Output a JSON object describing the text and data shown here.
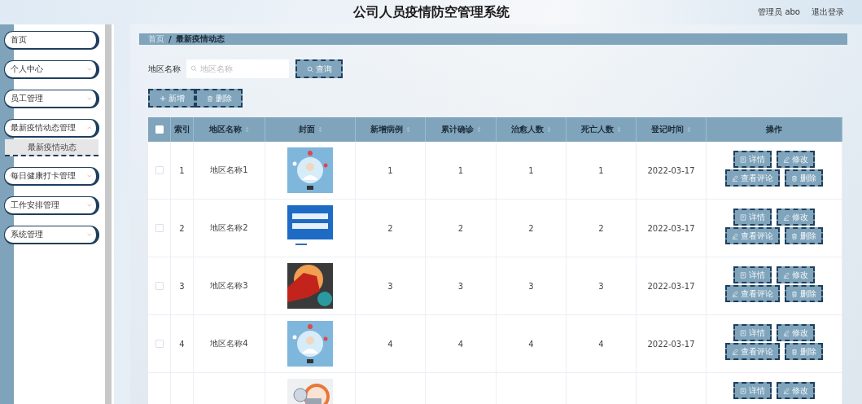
{
  "header": {
    "title": "公司人员疫情防空管理系统",
    "user": "管理员 abo",
    "logout": "退出登录"
  },
  "sidebar": {
    "items": [
      {
        "label": "首页"
      },
      {
        "label": "个人中心",
        "expanded": false
      },
      {
        "label": "员工管理",
        "expanded": false
      },
      {
        "label": "最新疫情动态管理",
        "expanded": true,
        "children": [
          {
            "label": "最新疫情动态",
            "selected": true
          }
        ]
      },
      {
        "label": "每日健康打卡管理",
        "expanded": false
      },
      {
        "label": "工作安排管理",
        "expanded": false
      },
      {
        "label": "系统管理",
        "expanded": false
      }
    ]
  },
  "breadcrumb": [
    "首页",
    "/",
    "最新疫情动态"
  ],
  "search": {
    "label": "地区名称",
    "placeholder": "地区名称",
    "button": "查询"
  },
  "toolbar": [
    {
      "kind": "add",
      "label": "新增"
    },
    {
      "kind": "delete",
      "label": "删除"
    }
  ],
  "table": {
    "columns": [
      {
        "label": "索引",
        "sortable": false
      },
      {
        "label": "地区名称",
        "sortable": true
      },
      {
        "label": "封面",
        "sortable": true
      },
      {
        "label": "新增病例",
        "sortable": true
      },
      {
        "label": "累计确诊",
        "sortable": true
      },
      {
        "label": "治愈人数",
        "sortable": true
      },
      {
        "label": "死亡人数",
        "sortable": true
      },
      {
        "label": "登记时间",
        "sortable": true
      },
      {
        "label": "操作",
        "sortable": false
      }
    ],
    "header_checked": false,
    "rows": [
      {
        "checked": false,
        "cells": [
          "1",
          "地区名称1"
        ],
        "cover": {
          "kind": "picture"
        },
        "values": [
          "1",
          "1",
          "1",
          "1",
          "2022-03-17"
        ],
        "actions": [
          {
            "kind": "detail",
            "label": "详情"
          },
          {
            "kind": "edit",
            "label": "修改"
          },
          {
            "kind": "edit",
            "label": "查看评论"
          },
          {
            "kind": "delete",
            "label": "删除"
          }
        ]
      },
      {
        "checked": false,
        "cells": [
          "2",
          "地区名称2"
        ],
        "cover": {
          "kind": "picture"
        },
        "values": [
          "2",
          "2",
          "2",
          "2",
          "2022-03-17"
        ],
        "actions": [
          {
            "kind": "detail",
            "label": "详情"
          },
          {
            "kind": "edit",
            "label": "修改"
          },
          {
            "kind": "edit",
            "label": "查看评论"
          },
          {
            "kind": "delete",
            "label": "删除"
          }
        ]
      },
      {
        "checked": false,
        "cells": [
          "3",
          "地区名称3"
        ],
        "cover": {
          "kind": "picture"
        },
        "values": [
          "3",
          "3",
          "3",
          "3",
          "2022-03-17"
        ],
        "actions": [
          {
            "kind": "detail",
            "label": "详情"
          },
          {
            "kind": "edit",
            "label": "修改"
          },
          {
            "kind": "edit",
            "label": "查看评论"
          },
          {
            "kind": "delete",
            "label": "删除"
          }
        ]
      },
      {
        "checked": false,
        "cells": [
          "4",
          "地区名称4"
        ],
        "cover": {
          "kind": "picture"
        },
        "values": [
          "4",
          "4",
          "4",
          "4",
          "2022-03-17"
        ],
        "actions": [
          {
            "kind": "detail",
            "label": "详情"
          },
          {
            "kind": "edit",
            "label": "修改"
          },
          {
            "kind": "edit",
            "label": "查看评论"
          },
          {
            "kind": "delete",
            "label": "删除"
          }
        ]
      },
      {
        "cover": {
          "kind": "picture"
        },
        "actions": [
          {
            "kind": "detail",
            "label": "详情"
          },
          {
            "kind": "edit",
            "label": "修改"
          }
        ]
      }
    ]
  }
}
